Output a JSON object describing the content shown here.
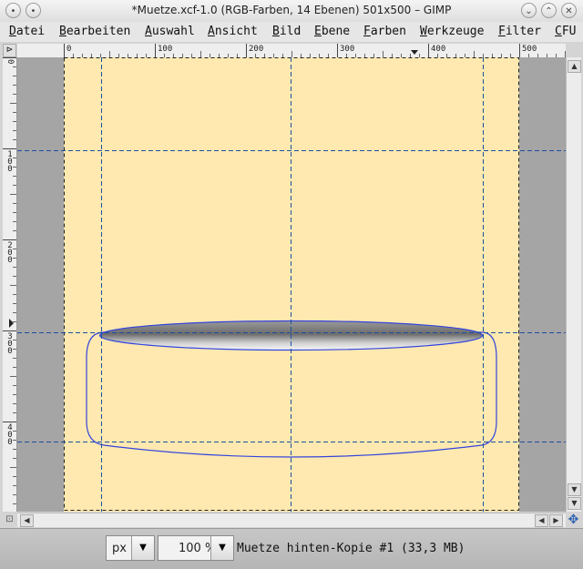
{
  "window": {
    "title": "*Muetze.xcf-1.0 (RGB-Farben, 14 Ebenen) 501x500 – GIMP",
    "minimize_glyph": "⌄",
    "maximize_glyph": "⌃",
    "close_glyph": "✕",
    "menu_glyph": "•"
  },
  "menubar": {
    "items": [
      "Datei",
      "Bearbeiten",
      "Auswahl",
      "Ansicht",
      "Bild",
      "Ebene",
      "Farben",
      "Werkzeuge",
      "Filter",
      "CFU"
    ]
  },
  "ruler_top": {
    "labels": [
      "0",
      "100",
      "200",
      "300",
      "400",
      "500"
    ]
  },
  "ruler_left": {
    "labels": [
      "0",
      "100",
      "200",
      "300",
      "400"
    ]
  },
  "scrollbars": {
    "up": "▲",
    "down": "▼",
    "left": "◀",
    "right": "▶",
    "down_small": "▼"
  },
  "statusbar": {
    "unit": "px",
    "zoom": "100 %",
    "dropdown_arrow": "▼",
    "message": "Muetze hinten-Kopie #1 (33,3 MB)"
  },
  "icons": {
    "corner": "⊳",
    "quickmask": "⊡",
    "navigate": "✥"
  }
}
